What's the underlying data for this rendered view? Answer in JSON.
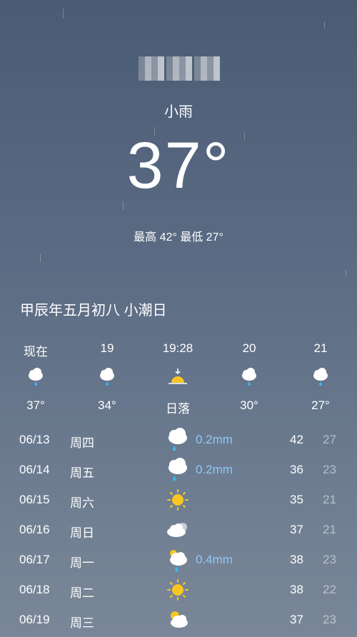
{
  "current": {
    "condition": "小雨",
    "temperature": "37°",
    "high_low": "最高 42° 最低 27°",
    "lunar_date": "甲辰年五月初八 小潮日"
  },
  "hourly": [
    {
      "time": "现在",
      "icon": "rain-cloud-icon",
      "temp": "37°"
    },
    {
      "time": "19",
      "icon": "rain-cloud-icon",
      "temp": "34°"
    },
    {
      "time": "19:28",
      "icon": "sunset-icon",
      "temp": "日落"
    },
    {
      "time": "20",
      "icon": "rain-cloud-icon",
      "temp": "30°"
    },
    {
      "time": "21",
      "icon": "rain-cloud-icon",
      "temp": "27°"
    }
  ],
  "daily": [
    {
      "date": "06/13",
      "weekday": "周四",
      "icon": "rain-cloud-icon",
      "precip": "0.2mm",
      "high": "42",
      "low": "27"
    },
    {
      "date": "06/14",
      "weekday": "周五",
      "icon": "rain-cloud-icon",
      "precip": "0.2mm",
      "high": "36",
      "low": "23"
    },
    {
      "date": "06/15",
      "weekday": "周六",
      "icon": "sun-icon",
      "precip": "",
      "high": "35",
      "low": "21"
    },
    {
      "date": "06/16",
      "weekday": "周日",
      "icon": "cloudy-icon",
      "precip": "",
      "high": "37",
      "low": "21"
    },
    {
      "date": "06/17",
      "weekday": "周一",
      "icon": "sun-rain-cloud-icon",
      "precip": "0.4mm",
      "high": "38",
      "low": "23"
    },
    {
      "date": "06/18",
      "weekday": "周二",
      "icon": "sun-icon",
      "precip": "",
      "high": "38",
      "low": "22"
    },
    {
      "date": "06/19",
      "weekday": "周三",
      "icon": "partly-cloudy-icon",
      "precip": "",
      "high": "37",
      "low": "23"
    }
  ],
  "colors": {
    "precip": "#8fc9f5",
    "sun": "#f7c623",
    "rain_drop": "#3fb6f0"
  }
}
